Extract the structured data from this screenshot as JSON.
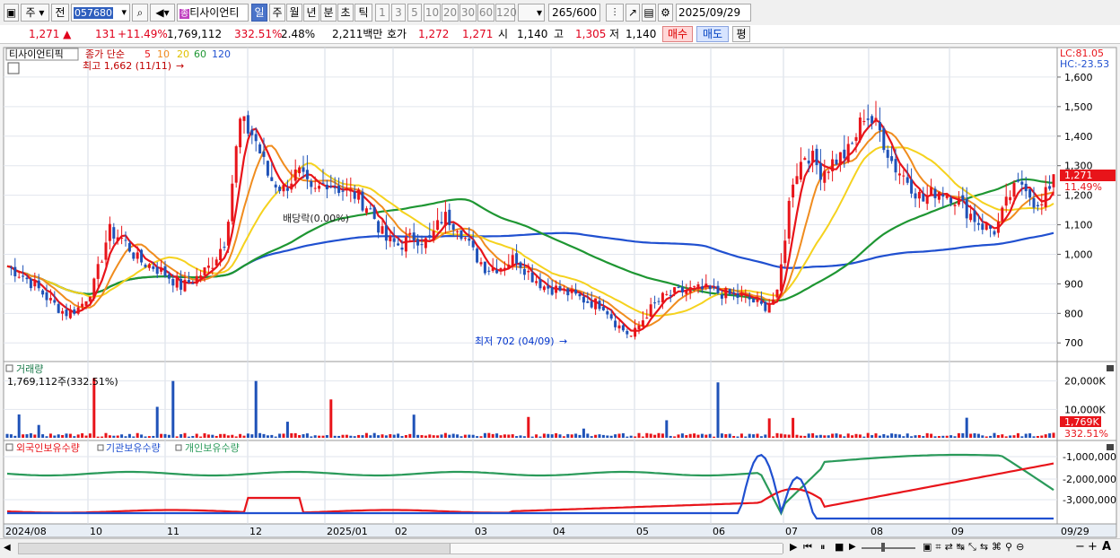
{
  "toolbar": {
    "mode_select": "주",
    "prev_label": "전",
    "stock_code": "057680",
    "stock_name": "티사이언티",
    "exchange_badge": "종",
    "periods": [
      "일",
      "주",
      "월",
      "년",
      "분",
      "초",
      "틱"
    ],
    "selected_period": "일",
    "intervals": [
      "1",
      "3",
      "5",
      "10",
      "20",
      "30",
      "60",
      "120"
    ],
    "bar_count": "265",
    "bar_total": "/600",
    "date": "2025/09/29"
  },
  "infobar": {
    "price": "1,271",
    "change": "131",
    "change_pct": "+11.49%",
    "volume": "1,769,112",
    "volume_ratio": "332.51%",
    "turnover": "2.48%",
    "amount": "2,211백만",
    "ask_label": "호가",
    "ask": "1,272",
    "bid": "1,271",
    "open_label": "시",
    "open": "1,140",
    "high_label": "고",
    "high": "1,305",
    "low_label": "저",
    "low": "1,140",
    "buy_label": "매수",
    "sell_label": "매도",
    "avg_label": "평"
  },
  "price_panel": {
    "name_tag": "티사이언티픽",
    "legend_main": "종가 단순",
    "legend_periods": [
      "5",
      "10",
      "20",
      "60",
      "120"
    ],
    "max_label": "최고 1,662 (11/11)",
    "min_label": "최저 702 (04/09)",
    "dividend_label": "배당락(0.00%)",
    "lc_label": "LC:81.05",
    "hc_label": "HC:-23.53",
    "price_tag": "1,271",
    "pct_tag": "11.49%"
  },
  "volume_panel": {
    "title": "거래량",
    "value": "1,769,112주(332.51%)",
    "tag": "1,769K",
    "pct_tag": "332.51%"
  },
  "holding_panel": {
    "legend": [
      "외국인보유수량",
      "기관보유수량",
      "개인보유수량"
    ]
  },
  "colors": {
    "ma5": "#e8141a",
    "ma10": "#f08c1e",
    "ma20": "#f5d21e",
    "ma60": "#1e9632",
    "ma120": "#2050d0",
    "up": "#e8141a",
    "down": "#1f52b8",
    "foreign": "#e8141a",
    "institution": "#2050d0",
    "individual": "#2a9a5a"
  },
  "chart_data": [
    {
      "type": "candlestick",
      "x_labels": [
        "2024/08",
        "10",
        "11",
        "12",
        "2025/01",
        "02",
        "03",
        "04",
        "05",
        "06",
        "07",
        "08",
        "09",
        "09/29"
      ],
      "y_ticks": [
        700,
        800,
        900,
        1000,
        1100,
        1200,
        1300,
        1400,
        1500,
        1600
      ],
      "ylim": [
        640,
        1700
      ],
      "grid": true,
      "close_series": [
        {
          "d": "2024/08",
          "v": 960
        },
        {
          "d": "",
          "v": 930
        },
        {
          "d": "",
          "v": 890
        },
        {
          "d": "",
          "v": 840
        },
        {
          "d": "",
          "v": 800
        },
        {
          "d": "",
          "v": 820
        },
        {
          "d": "",
          "v": 900
        },
        {
          "d": "10",
          "v": 1080
        },
        {
          "d": "",
          "v": 1050
        },
        {
          "d": "",
          "v": 980
        },
        {
          "d": "",
          "v": 960
        },
        {
          "d": "",
          "v": 930
        },
        {
          "d": "",
          "v": 890
        },
        {
          "d": "",
          "v": 920
        },
        {
          "d": "",
          "v": 960
        },
        {
          "d": "11",
          "v": 1050
        },
        {
          "d": "",
          "v": 1450
        },
        {
          "d": "",
          "v": 1400
        },
        {
          "d": "",
          "v": 1260
        },
        {
          "d": "",
          "v": 1220
        },
        {
          "d": "",
          "v": 1280
        },
        {
          "d": "",
          "v": 1200
        },
        {
          "d": "12",
          "v": 1250
        },
        {
          "d": "",
          "v": 1220
        },
        {
          "d": "",
          "v": 1200
        },
        {
          "d": "",
          "v": 1150
        },
        {
          "d": "",
          "v": 1050
        },
        {
          "d": "",
          "v": 1030
        },
        {
          "d": "",
          "v": 1060
        },
        {
          "d": "2025/01",
          "v": 1040
        },
        {
          "d": "",
          "v": 1130
        },
        {
          "d": "",
          "v": 1100
        },
        {
          "d": "02",
          "v": 1010
        },
        {
          "d": "",
          "v": 950
        },
        {
          "d": "",
          "v": 960
        },
        {
          "d": "",
          "v": 990
        },
        {
          "d": "",
          "v": 930
        },
        {
          "d": "03",
          "v": 890
        },
        {
          "d": "",
          "v": 880
        },
        {
          "d": "",
          "v": 860
        },
        {
          "d": "",
          "v": 840
        },
        {
          "d": "",
          "v": 830
        },
        {
          "d": "04",
          "v": 760
        },
        {
          "d": "",
          "v": 720
        },
        {
          "d": "",
          "v": 800
        },
        {
          "d": "",
          "v": 850
        },
        {
          "d": "",
          "v": 870
        },
        {
          "d": "",
          "v": 880
        },
        {
          "d": "05",
          "v": 880
        },
        {
          "d": "",
          "v": 870
        },
        {
          "d": "",
          "v": 860
        },
        {
          "d": "",
          "v": 850
        },
        {
          "d": "",
          "v": 820
        },
        {
          "d": "06",
          "v": 860
        },
        {
          "d": "",
          "v": 1250
        },
        {
          "d": "",
          "v": 1350
        },
        {
          "d": "",
          "v": 1280
        },
        {
          "d": "",
          "v": 1320
        },
        {
          "d": "07",
          "v": 1350
        },
        {
          "d": "",
          "v": 1480
        },
        {
          "d": "",
          "v": 1420
        },
        {
          "d": "",
          "v": 1300
        },
        {
          "d": "",
          "v": 1250
        },
        {
          "d": "08",
          "v": 1180
        },
        {
          "d": "",
          "v": 1220
        },
        {
          "d": "",
          "v": 1200
        },
        {
          "d": "",
          "v": 1150
        },
        {
          "d": "09",
          "v": 1100
        },
        {
          "d": "",
          "v": 1080
        },
        {
          "d": "",
          "v": 1200
        },
        {
          "d": "",
          "v": 1250
        },
        {
          "d": "",
          "v": 1140
        },
        {
          "d": "09/29",
          "v": 1271
        }
      ],
      "moving_averages": [
        5,
        10,
        20,
        60,
        120
      ]
    },
    {
      "type": "bar",
      "title": "거래량",
      "y_ticks": [
        "10,000K",
        "20,000K"
      ],
      "spikes": [
        {
          "x": "10",
          "v": 21000
        },
        {
          "x": "11",
          "v": 20000
        },
        {
          "x": "12",
          "v": 20000
        },
        {
          "x": "2025/01",
          "v": 13500
        },
        {
          "x": "06",
          "v": 19500
        },
        {
          "x": "07",
          "v": 7000
        },
        {
          "x": "09/29",
          "v": 1769
        }
      ]
    },
    {
      "type": "line",
      "series": [
        {
          "name": "외국인보유수량"
        },
        {
          "name": "기관보유수량"
        },
        {
          "name": "개인보유수량"
        }
      ],
      "y_ticks": [
        "-1,000,000",
        "-2,000,000",
        "-3,000,000"
      ]
    }
  ]
}
